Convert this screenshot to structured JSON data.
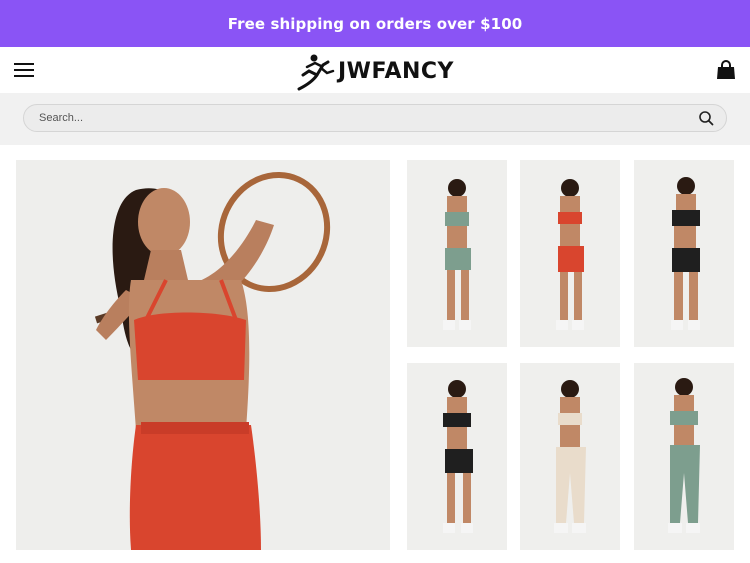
{
  "promo": {
    "text": "Free shipping on orders over $100"
  },
  "header": {
    "brand": "JWFANCY",
    "menu_icon": "hamburger-menu-icon",
    "cart_icon": "shopping-bag-icon"
  },
  "search": {
    "placeholder": "Search...",
    "icon": "search-icon"
  },
  "colors": {
    "promo_bg": "#8a54f5",
    "search_bg": "#f1f1f1"
  },
  "gallery": {
    "main_image": {
      "description_icon": "product-photo-red-set"
    },
    "thumbnails": [
      {
        "color": "#7d9e8e"
      },
      {
        "color": "#d9452e"
      },
      {
        "color": "#1f1f1f"
      },
      {
        "color": "#1f1f1f"
      },
      {
        "color": "#e9dccb"
      },
      {
        "color": "#7d9e8e"
      }
    ]
  }
}
